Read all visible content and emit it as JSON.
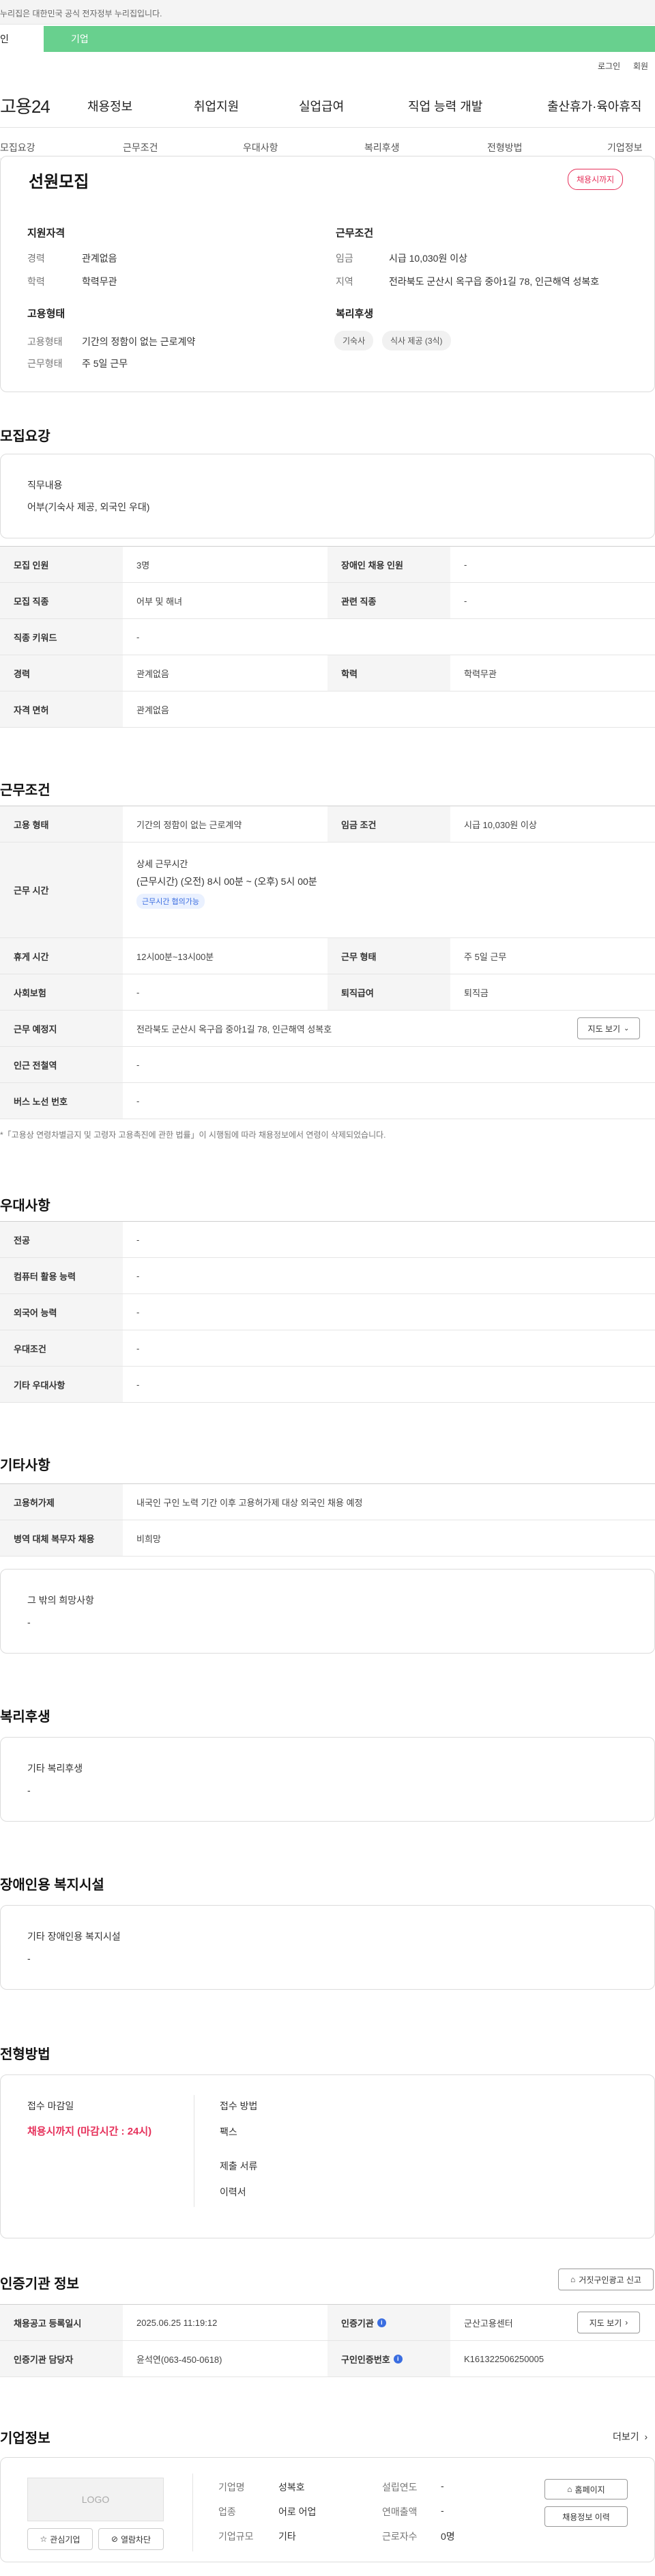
{
  "gov_banner": {
    "text": "누리집은 대한민국 공식 전자정부 누리집입니다."
  },
  "top_tabs": {
    "individual": "인",
    "company": "기업"
  },
  "util": {
    "login": "로그인",
    "signup": "회원"
  },
  "header": {
    "logo": "고용24",
    "nav": [
      "채용정보",
      "취업지원",
      "실업급여",
      "직업 능력 개발",
      "출산휴가·육아휴직"
    ]
  },
  "subnav": [
    "모집요강",
    "근무조건",
    "우대사항",
    "복리후생",
    "전형방법",
    "기업정보"
  ],
  "summary": {
    "title": "선원모집",
    "status_badge": "채용시까지",
    "qualification": {
      "heading": "지원자격",
      "career_label": "경력",
      "career_value": "관계없음",
      "education_label": "학력",
      "education_value": "학력무관"
    },
    "work_cond": {
      "heading": "근무조건",
      "wage_label": "임금",
      "wage_value": "시급 10,030원 이상",
      "region_label": "지역",
      "region_value": "전라북도 군산시 옥구읍 중아1길 78, 인근해역 성복호"
    },
    "employment": {
      "heading": "고용형태",
      "type_label": "고용형태",
      "type_value": "기간의 정함이 없는 근로계약",
      "form_label": "근무형태",
      "form_value": "주 5일 근무"
    },
    "welfare": {
      "heading": "복리후생",
      "chips": [
        "기숙사",
        "식사 제공 (3식)"
      ]
    }
  },
  "recruit": {
    "section_title": "모집요강",
    "duty_label": "직무내용",
    "duty_value": "어부(기숙사 제공, 외국인 우대)",
    "rows": [
      {
        "l1": "모집 인원",
        "v1": "3명",
        "l2": "장애인 채용 인원",
        "v2": "-"
      },
      {
        "l1": "모집 직종",
        "v1": "어부 및 해녀",
        "l2": "관련 직종",
        "v2": "-"
      },
      {
        "l1": "직종 키워드",
        "v1": "-"
      },
      {
        "l1": "경력",
        "v1": "관계없음",
        "l2": "학력",
        "v2": "학력무관"
      },
      {
        "l1": "자격 면허",
        "v1": "관계없음"
      }
    ]
  },
  "conditions": {
    "section_title": "근무조건",
    "r1": {
      "l1": "고용 형태",
      "v1": "기간의 정함이 없는 근로계약",
      "l2": "임금 조건",
      "v2": "시급 10,030원 이상"
    },
    "hours": {
      "label": "근무 시간",
      "heading": "상세 근무시간",
      "detail": "(근무시간) (오전) 8시 00분 ~ (오후) 5시 00분",
      "chip": "근무시간 협의가능"
    },
    "r3": {
      "l1": "휴게 시간",
      "v1": "12시00분~13시00분",
      "l2": "근무 형태",
      "v2": "주 5일 근무"
    },
    "r4": {
      "l1": "사회보험",
      "v1": "-",
      "l2": "퇴직급여",
      "v2": "퇴직금"
    },
    "r5": {
      "l1": "근무 예정지",
      "v1": "전라북도 군산시 옥구읍 중아1길 78, 인근해역 성복호",
      "map_btn": "지도 보기"
    },
    "r6": {
      "l1": "인근 전철역",
      "v1": "-"
    },
    "r7": {
      "l1": "버스 노선 번호",
      "v1": "-"
    },
    "note": "*「고용상 연령차별금지 및 고령자 고용촉진에 관한 법률」이 시행됨에 따라 채용정보에서 연령이 삭제되었습니다."
  },
  "preference": {
    "section_title": "우대사항",
    "rows": [
      {
        "label": "전공",
        "value": "-"
      },
      {
        "label": "컴퓨터 활용 능력",
        "value": "-"
      },
      {
        "label": "외국어 능력",
        "value": "-"
      },
      {
        "label": "우대조건",
        "value": "-"
      },
      {
        "label": "기타 우대사항",
        "value": "-"
      }
    ]
  },
  "etc": {
    "section_title": "기타사항",
    "rows": [
      {
        "label": "고용허가제",
        "value": "내국인 구인 노력 기간 이후 고용허가제 대상 외국인 채용 예정"
      },
      {
        "label": "병역 대체 복무자 채용",
        "value": "비희망"
      }
    ],
    "box_label": "그 밖의 희망사항",
    "box_value": "-"
  },
  "welfare": {
    "section_title": "복리후생",
    "box_label": "기타 복리후생",
    "box_value": "-"
  },
  "disability": {
    "section_title": "장애인용 복지시설",
    "box_label": "기타 장애인용 복지시설",
    "box_value": "-"
  },
  "screening": {
    "section_title": "전형방법",
    "deadline_label": "접수 마감일",
    "deadline_value": "채용시까지 (마감시간 : 24시)",
    "method_label": "접수 방법",
    "method_value": "팩스",
    "docs_label": "제출 서류",
    "docs_value": "이력서"
  },
  "agency": {
    "section_title": "인증기관 정보",
    "report_btn": "거짓구인광고 신고",
    "r1": {
      "l1": "채용공고 등록일시",
      "v1": "2025.06.25 11:19:12",
      "l2": "인증기관",
      "v2": "군산고용센터",
      "map_btn": "지도 보기"
    },
    "r2": {
      "l1": "인증기관 담당자",
      "v1": "윤석연(063-450-0618)",
      "l2": "구인인증번호",
      "v2": "K161322506250005"
    }
  },
  "company": {
    "section_title": "기업정보",
    "more": "더보기",
    "logo_text": "LOGO",
    "interest_btn": "관심기업",
    "block_btn": "열람차단",
    "name_label": "기업명",
    "name_value": "성복호",
    "industry_label": "업종",
    "industry_value": "어로 어업",
    "size_label": "기업규모",
    "size_value": "기타",
    "founded_label": "설립연도",
    "founded_value": "-",
    "sales_label": "연매출액",
    "sales_value": "-",
    "employees_label": "근로자수",
    "employees_value": "0명",
    "homepage_btn": "홈페이지",
    "history_btn": "채용정보 이력"
  }
}
